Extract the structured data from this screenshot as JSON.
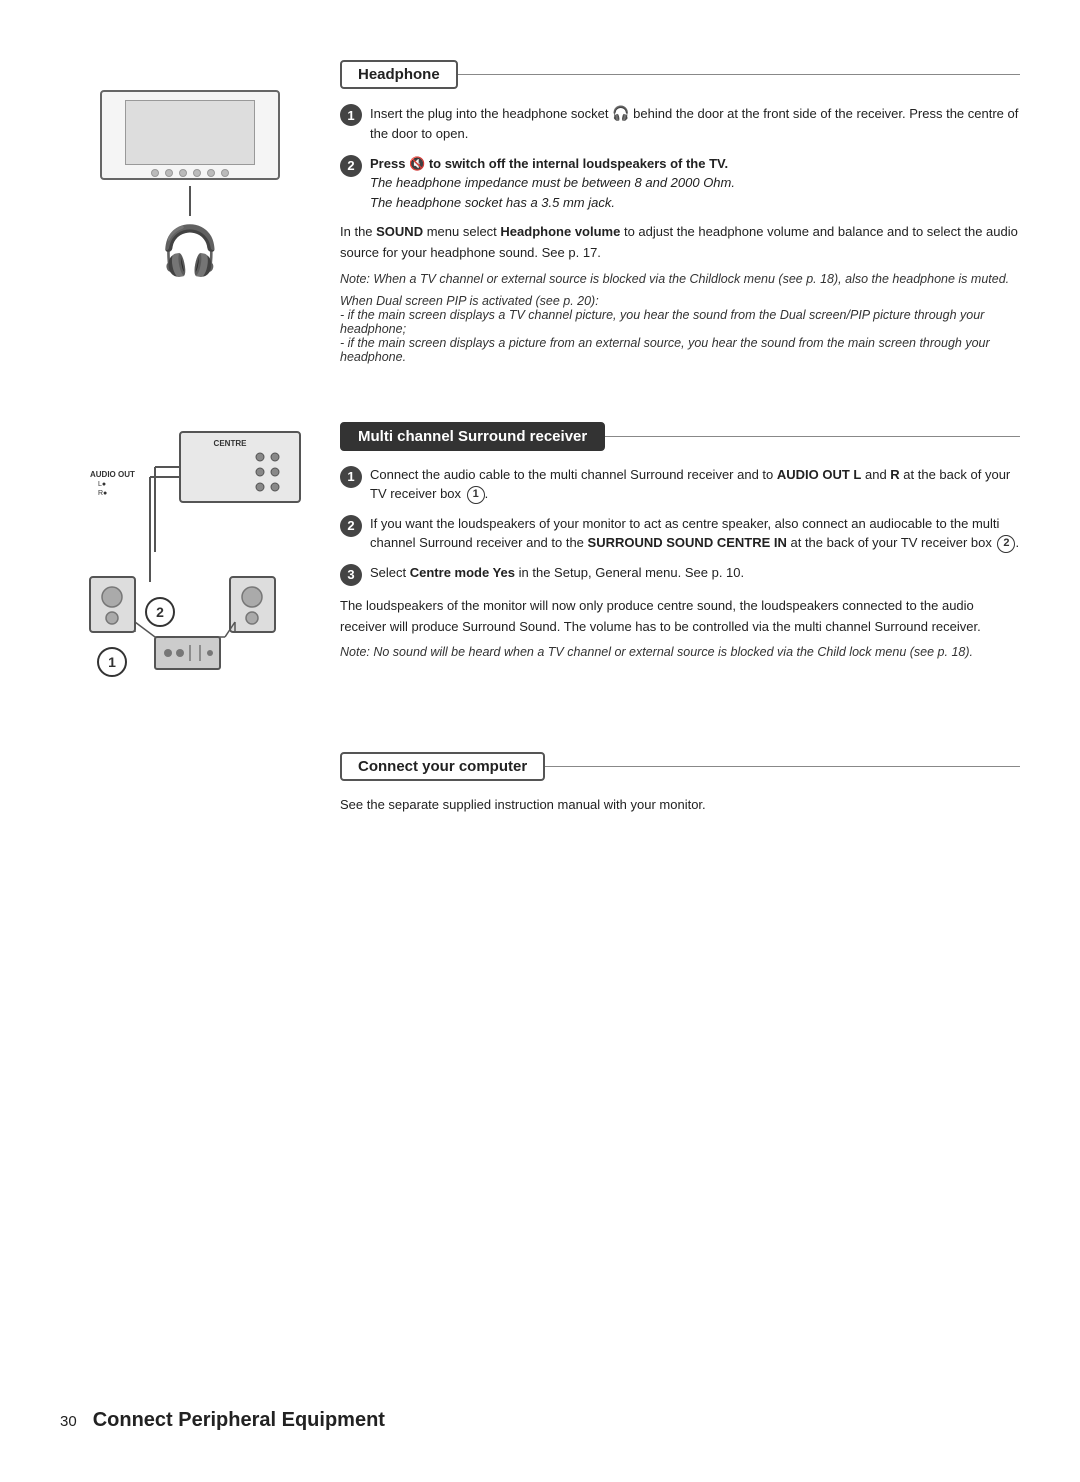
{
  "page": {
    "footer_num": "30",
    "footer_title": "Connect Peripheral Equipment"
  },
  "headphone": {
    "title": "Headphone",
    "step1": "Insert the plug into the headphone socket  behind the door at the front side of the receiver. Press the centre of the door to open.",
    "step2_bold": "Press  to switch off the internal loudspeakers of the TV.",
    "step2_italic1": "The headphone impedance must be between 8 and 2000 Ohm.",
    "step2_italic2": "The headphone socket has a 3.5 mm jack.",
    "body1_prefix": "In the ",
    "body1_bold1": "SOUND",
    "body1_mid": " menu select ",
    "body1_bold2": "Headphone volume",
    "body1_suffix": " to adjust the headphone volume and balance and to select the audio source for your headphone sound. See p. 17.",
    "note1": "Note: When a TV channel or external source is blocked via the Childlock menu (see p. 18), also the headphone is muted.",
    "note2_title": "When Dual screen PIP is activated (see p. 20):",
    "note2_line1": "- if the main screen displays a TV channel picture, you hear the sound from the Dual screen/PIP picture through your headphone;",
    "note2_line2": "- if the main screen displays a picture from an external source, you hear the sound from the main screen through your headphone."
  },
  "surround": {
    "title": "Multi channel Surround receiver",
    "step1": "Connect the audio cable to the multi channel Surround receiver and to ",
    "step1_bold": "AUDIO OUT L",
    "step1_mid": " and ",
    "step1_bold2": "R",
    "step1_suffix": " at the back of your TV receiver box",
    "step2": "If you want the loudspeakers of your monitor to act as centre speaker, also connect an audiocable to the multi channel Surround receiver and to the ",
    "step2_bold": "SURROUND SOUND CENTRE IN",
    "step2_suffix": " at the back of your TV receiver box",
    "step3_prefix": "Select ",
    "step3_bold": "Centre mode Yes",
    "step3_suffix": " in the Setup, General menu. See p. 10.",
    "body1": "The loudspeakers of the monitor will now only produce centre sound, the loudspeakers connected to the audio receiver will produce Surround Sound. The volume has to be controlled via the multi channel Surround receiver.",
    "note": "Note: No sound will be heard when a TV channel or external source is blocked via the Child lock menu (see p. 18)."
  },
  "computer": {
    "title": "Connect your computer",
    "body": "See the separate supplied instruction manual with your monitor."
  }
}
